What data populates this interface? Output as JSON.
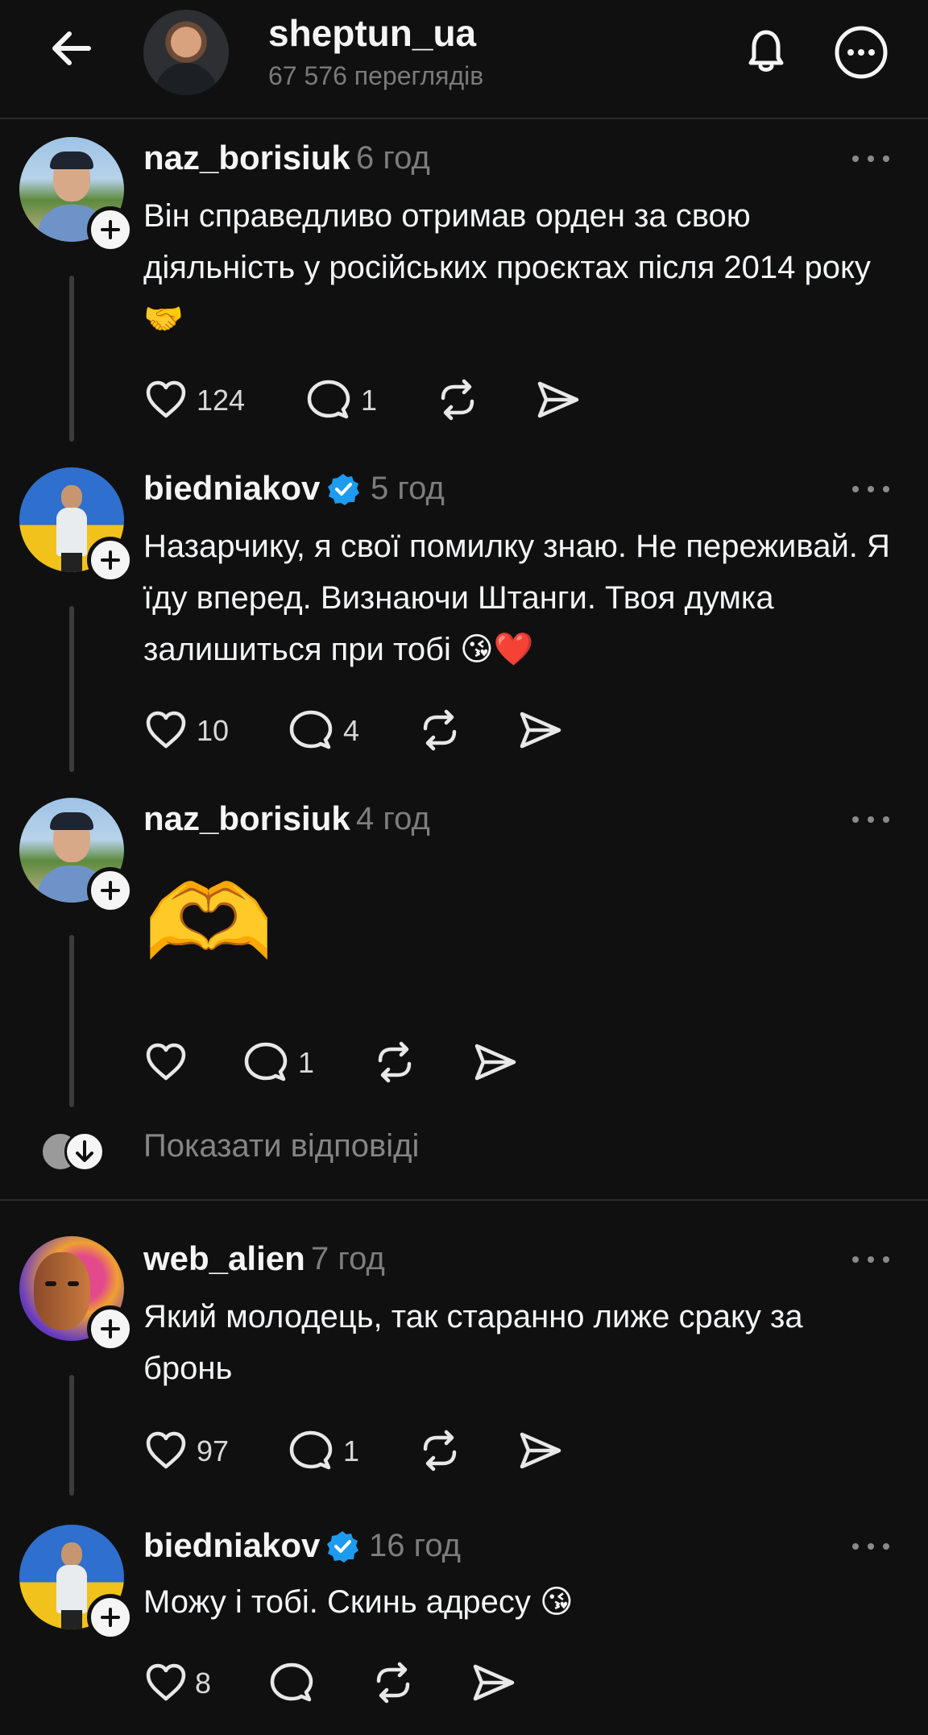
{
  "header": {
    "title": "sheptun_ua",
    "views": "67 576 переглядів"
  },
  "posts": [
    {
      "author": "naz_borisiuk",
      "time": "6 год",
      "text": "Він справедливо отримав орден за свою діяльність у російських проєктах після 2014 року🤝",
      "likes": "124",
      "replies": "1"
    },
    {
      "author": "biedniakov",
      "verified": true,
      "time": "5 год",
      "text": "Назарчику, я свої помилку знаю. Не переживай. Я їду вперед. Визнаючи Штанги. Твоя думка залишиться при тобі 😘❤️",
      "likes": "10",
      "replies": "4"
    },
    {
      "author": "naz_borisiuk",
      "time": "4 год",
      "text": "🫶",
      "likes": "",
      "replies": "1"
    },
    {
      "author": "web_alien",
      "time": "7 год",
      "text": "Який молодець, так старанно лиже сраку за бронь",
      "likes": "97",
      "replies": "1"
    },
    {
      "author": "biedniakov",
      "verified": true,
      "time": "16 год",
      "text": "Можу і тобі. Скинь адресу 😘",
      "likes": "8",
      "replies": ""
    }
  ],
  "show_replies": "Показати відповіді",
  "icons": [
    "back-arrow-icon",
    "bell-icon",
    "more-icon",
    "heart-icon",
    "comment-icon",
    "repost-icon",
    "share-icon",
    "verified-icon",
    "plus-icon"
  ],
  "colors": {
    "background": "#101010",
    "text": "#f3f5f7",
    "muted": "#7d7d7d",
    "verified": "#1d9bf0"
  }
}
